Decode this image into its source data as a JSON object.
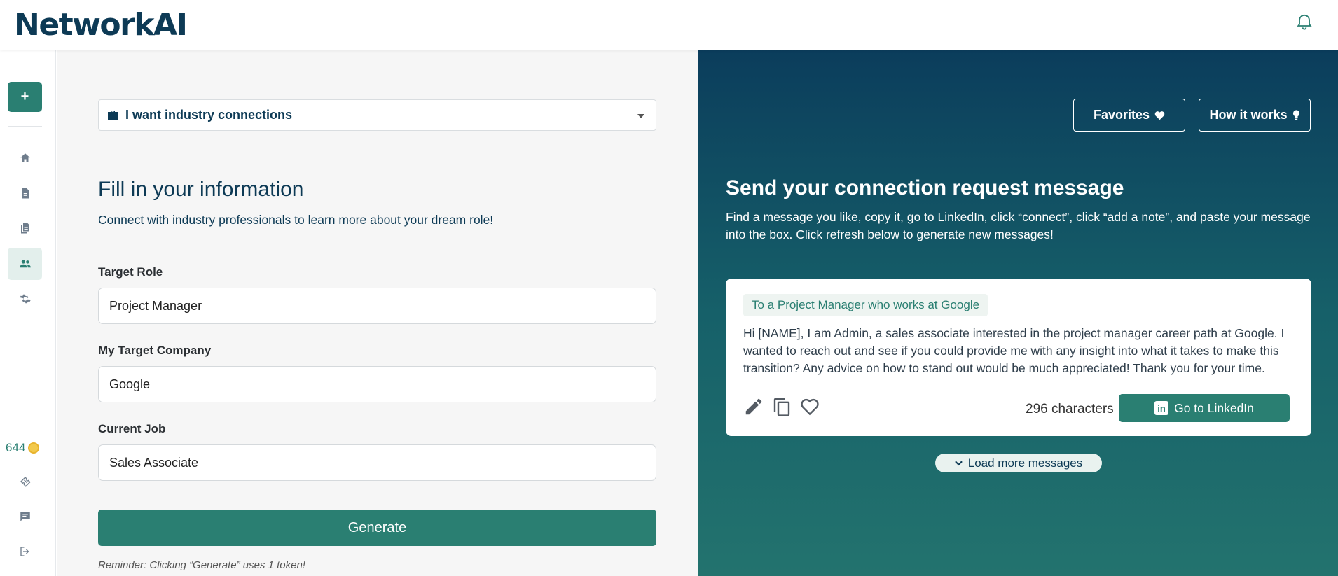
{
  "header": {
    "logo": "NetworkAI",
    "bell_icon": "bell-icon"
  },
  "sidebar": {
    "new_label": "+",
    "items": [
      {
        "icon": "home-icon"
      },
      {
        "icon": "document-icon"
      },
      {
        "icon": "documents-icon"
      },
      {
        "icon": "people-icon",
        "active": true
      },
      {
        "icon": "gear-icon"
      }
    ],
    "tokens": "644",
    "bottom_items": [
      {
        "icon": "ticket-icon"
      },
      {
        "icon": "chat-icon"
      },
      {
        "icon": "logout-icon"
      }
    ]
  },
  "form": {
    "mode_selected": "I want industry connections",
    "title": "Fill in your information",
    "subtitle": "Connect with industry professionals to learn more about your dream role!",
    "target_role_label": "Target Role",
    "target_role_value": "Project Manager",
    "target_company_label": "My Target Company",
    "target_company_value": "Google",
    "current_job_label": "Current Job",
    "current_job_value": "Sales Associate",
    "generate_label": "Generate",
    "reminder": "Reminder: Clicking “Generate” uses 1 token!"
  },
  "results": {
    "favorites_label": "Favorites",
    "how_it_works_label": "How it works",
    "title": "Send your connection request message",
    "description": "Find a message you like, copy it, go to LinkedIn, click “connect”, click “add a note”, and paste your message into the box. Click refresh below to generate new messages!",
    "message": {
      "tag": "To a Project Manager who works at Google",
      "body": "Hi [NAME], I am Admin, a sales associate interested in the project manager career path at Google. I wanted to reach out and see if you could provide me with any insight into what it takes to make this transition? Any advice on how to stand out would be much appreciated! Thank you for your time.",
      "char_count": "296 characters",
      "linkedin_label": "Go to LinkedIn",
      "linkedin_icon_text": "in"
    },
    "load_more_label": "Load more messages"
  },
  "colors": {
    "brand_navy": "#0d3a55",
    "brand_teal": "#2a7f72"
  }
}
